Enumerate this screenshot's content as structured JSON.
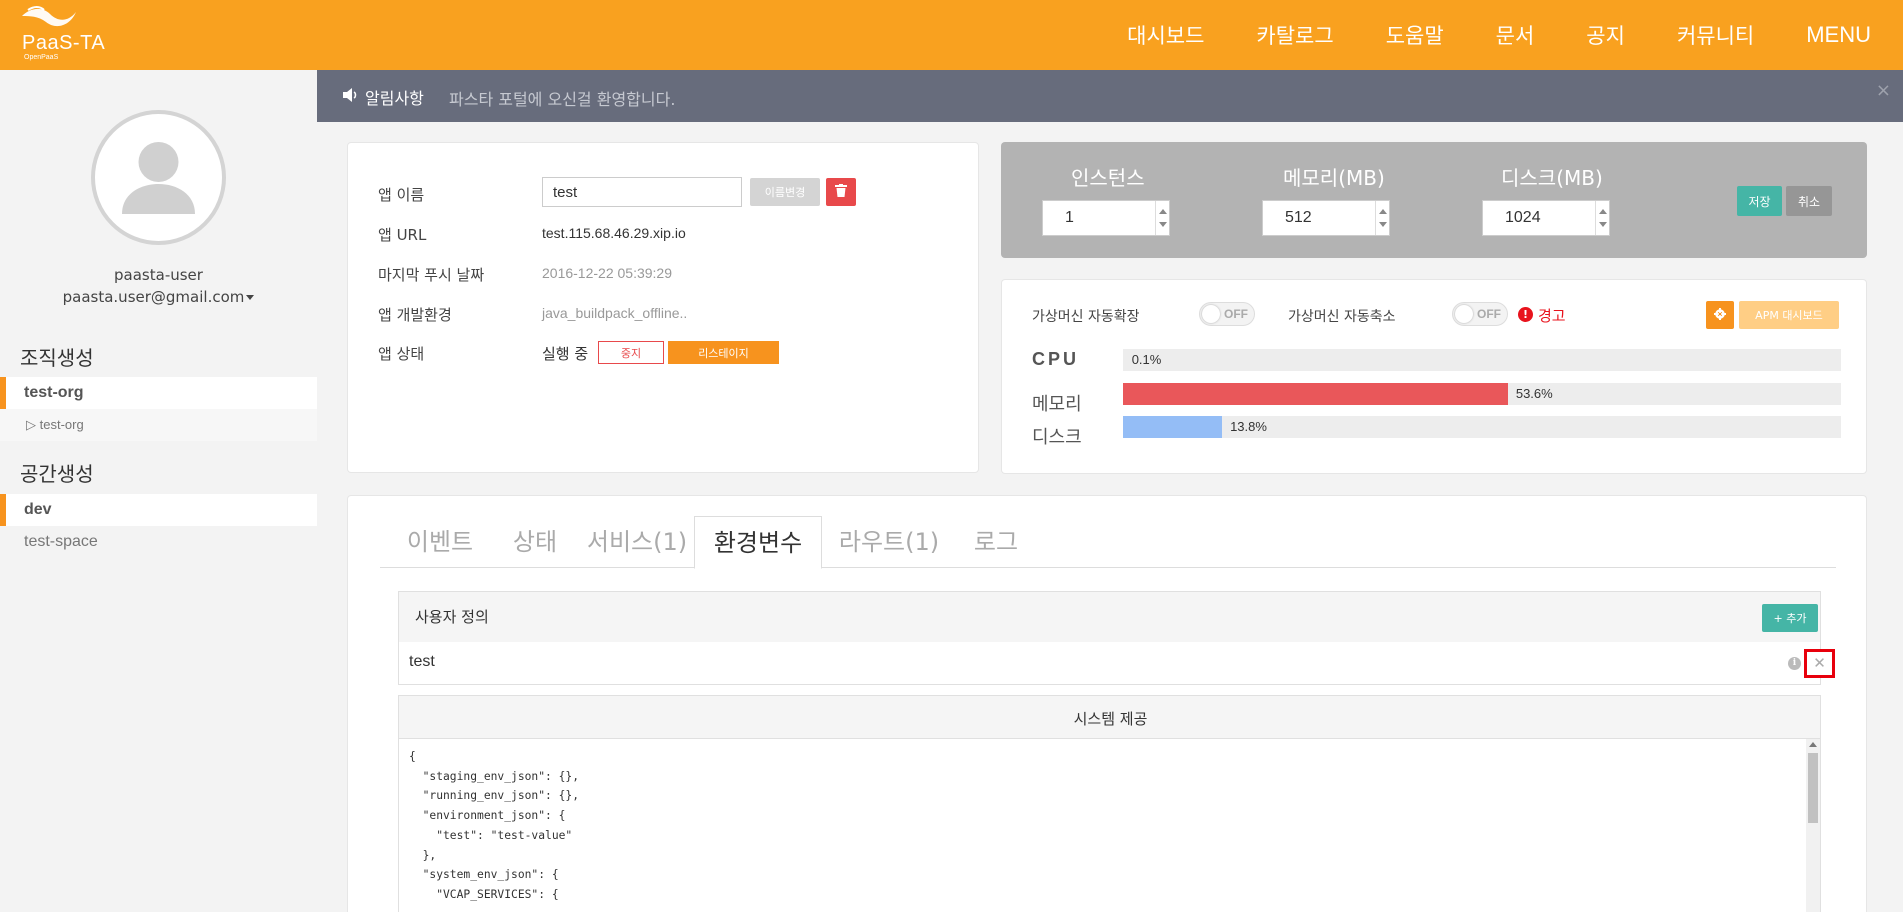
{
  "header": {
    "logo_text": "PaaS-TA",
    "logo_sub": "OpenPaaS",
    "nav": [
      "대시보드",
      "카탈로그",
      "도움말",
      "문서",
      "공지",
      "커뮤니티",
      "MENU"
    ]
  },
  "sidebar": {
    "user_name": "paasta-user",
    "user_email": "paasta.user@gmail.com",
    "org_section": "조직생성",
    "org_active": "test-org",
    "org_sub": "test-org",
    "space_section": "공간생성",
    "space_active": "dev",
    "space_other": "test-space"
  },
  "notice": {
    "label": "알림사항",
    "text": "파스타 포털에 오신걸 환영합니다.",
    "close": "×"
  },
  "app_info": {
    "name_label": "앱 이름",
    "name_value": "test",
    "rename_button": "이름변경",
    "url_label": "앱 URL",
    "url_value": "test.115.68.46.29.xip.io",
    "last_push_label": "마지막 푸시 날짜",
    "last_push_value": "2016-12-22 05:39:29",
    "buildpack_label": "앱 개발환경",
    "buildpack_value": "java_buildpack_offline..",
    "status_label": "앱 상태",
    "status_value": "실행 중",
    "stop_button": "중지",
    "restage_button": "리스테이지"
  },
  "resources": {
    "instances_label": "인스턴스",
    "instances_value": "1",
    "memory_label": "메모리(MB)",
    "memory_value": "512",
    "disk_label": "디스크(MB)",
    "disk_value": "1024",
    "save_button": "저장",
    "cancel_button": "취소"
  },
  "autoscale": {
    "scale_out_label": "가상머신 자동확장",
    "scale_out_state": "OFF",
    "scale_in_label": "가상머신 자동축소",
    "scale_in_state": "OFF",
    "warning_text": "경고",
    "apm_button": "APM 대시보드",
    "colors": {
      "memory": "#e9575a",
      "disk": "#94bdf6",
      "track": "#ededed"
    },
    "metrics": [
      {
        "label": "CPU",
        "percent": 0.1,
        "text": "0.1%"
      },
      {
        "label": "메모리",
        "percent": 53.6,
        "text": "53.6%"
      },
      {
        "label": "디스크",
        "percent": 13.8,
        "text": "13.8%"
      }
    ]
  },
  "tabs": [
    "이벤트",
    "상태",
    "서비스(1)",
    "환경변수",
    "라우트(1)",
    "로그"
  ],
  "active_tab": "환경변수",
  "env": {
    "user_defined_title": "사용자 정의",
    "add_button": "+ 추가",
    "user_vars": [
      {
        "key": "test"
      }
    ],
    "system_title": "시스템 제공",
    "system_json": "{\n  \"staging_env_json\": {},\n  \"running_env_json\": {},\n  \"environment_json\": {\n    \"test\": \"test-value\"\n  },\n  \"system_env_json\": {\n    \"VCAP_SERVICES\": {"
  }
}
